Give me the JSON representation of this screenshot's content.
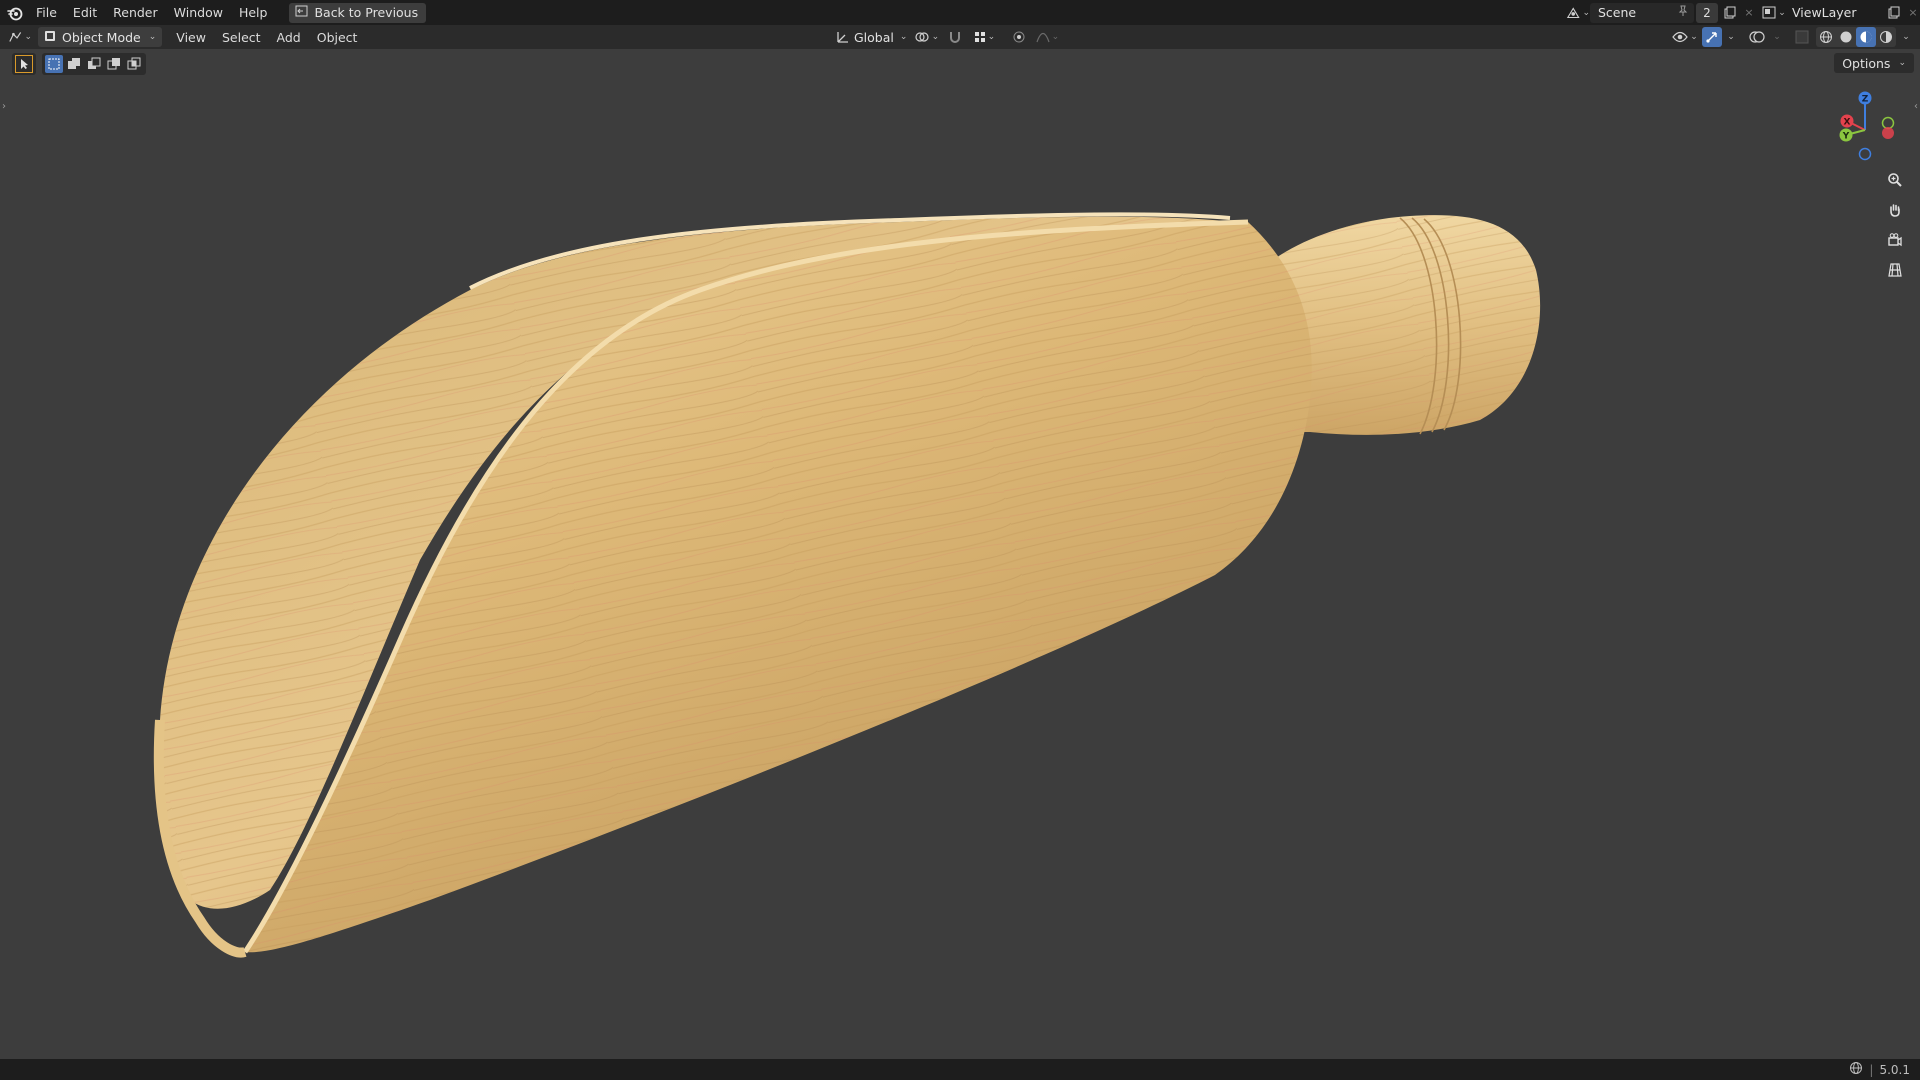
{
  "topbar": {
    "menus": [
      "File",
      "Edit",
      "Render",
      "Window",
      "Help"
    ],
    "back_label": "Back to Previous",
    "scene_name": "Scene",
    "scene_users": "2",
    "view_layer": "ViewLayer"
  },
  "header": {
    "mode": "Object Mode",
    "menus": [
      "View",
      "Select",
      "Add",
      "Object"
    ],
    "transform_orientation": "Global"
  },
  "viewport": {
    "options_label": "Options",
    "gizmo_axes": {
      "x": "X",
      "y": "Y",
      "z": "Z"
    }
  },
  "status": {
    "version": "5.0.1"
  },
  "colors": {
    "accent": "#4772b3",
    "axis_x": "#e4424d",
    "axis_y": "#8bc63f",
    "axis_z": "#3f7fe0",
    "wood": "#dcb879"
  }
}
